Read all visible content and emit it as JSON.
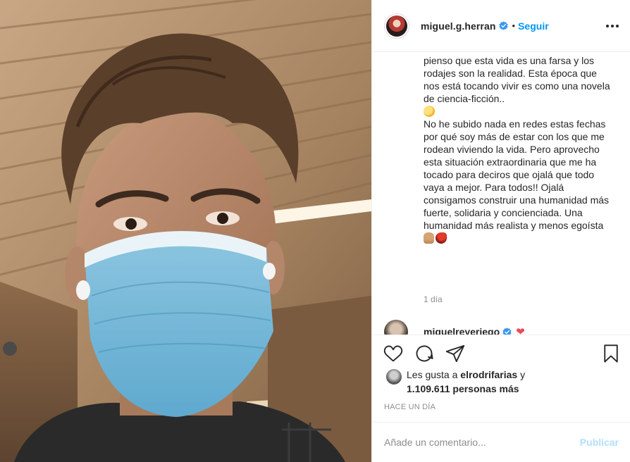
{
  "photo": {
    "subject": "selfie-masked-man"
  },
  "header": {
    "username": "miguel.g.herran",
    "follow_label": "Seguir",
    "separator": "•"
  },
  "caption": {
    "text": "contacto directo con un infectado.. a ratos pienso que esta vida es una farsa y los rodajes son la realidad. Esta época que nos está tocando vivir es como una novela de ciencia-ficción..\n",
    "text2": "No he subido nada en redes estas fechas por qué soy más de estar con los que me rodean viviendo la vida. Pero aprovecho esta situación extraordinaria que me ha tocado para deciros que ojalá que todo vaya a mejor. Para todos!! Ojalá consigamos construir una humanidad más fuerte, solidaria y concienciada. Una humanidad más realista y menos egoísta",
    "time": "1 día",
    "emojis": [
      "thinking-face",
      "raised-hand",
      "parrot"
    ]
  },
  "comment": {
    "username": "miguelreyeriego",
    "emoji": "❤"
  },
  "likes": {
    "prefix": "Les gusta a",
    "user": "elrodrifarias",
    "conj": "y",
    "count": "1.109.611 personas más"
  },
  "timestamp": "Hace un día",
  "add_comment": {
    "placeholder": "Añade un comentario...",
    "publish_label": "Publicar"
  },
  "colors": {
    "accent": "#0095f6",
    "verified": "#3897f0",
    "muted": "#8e8e8e",
    "publish_disabled": "#b2dffc"
  }
}
